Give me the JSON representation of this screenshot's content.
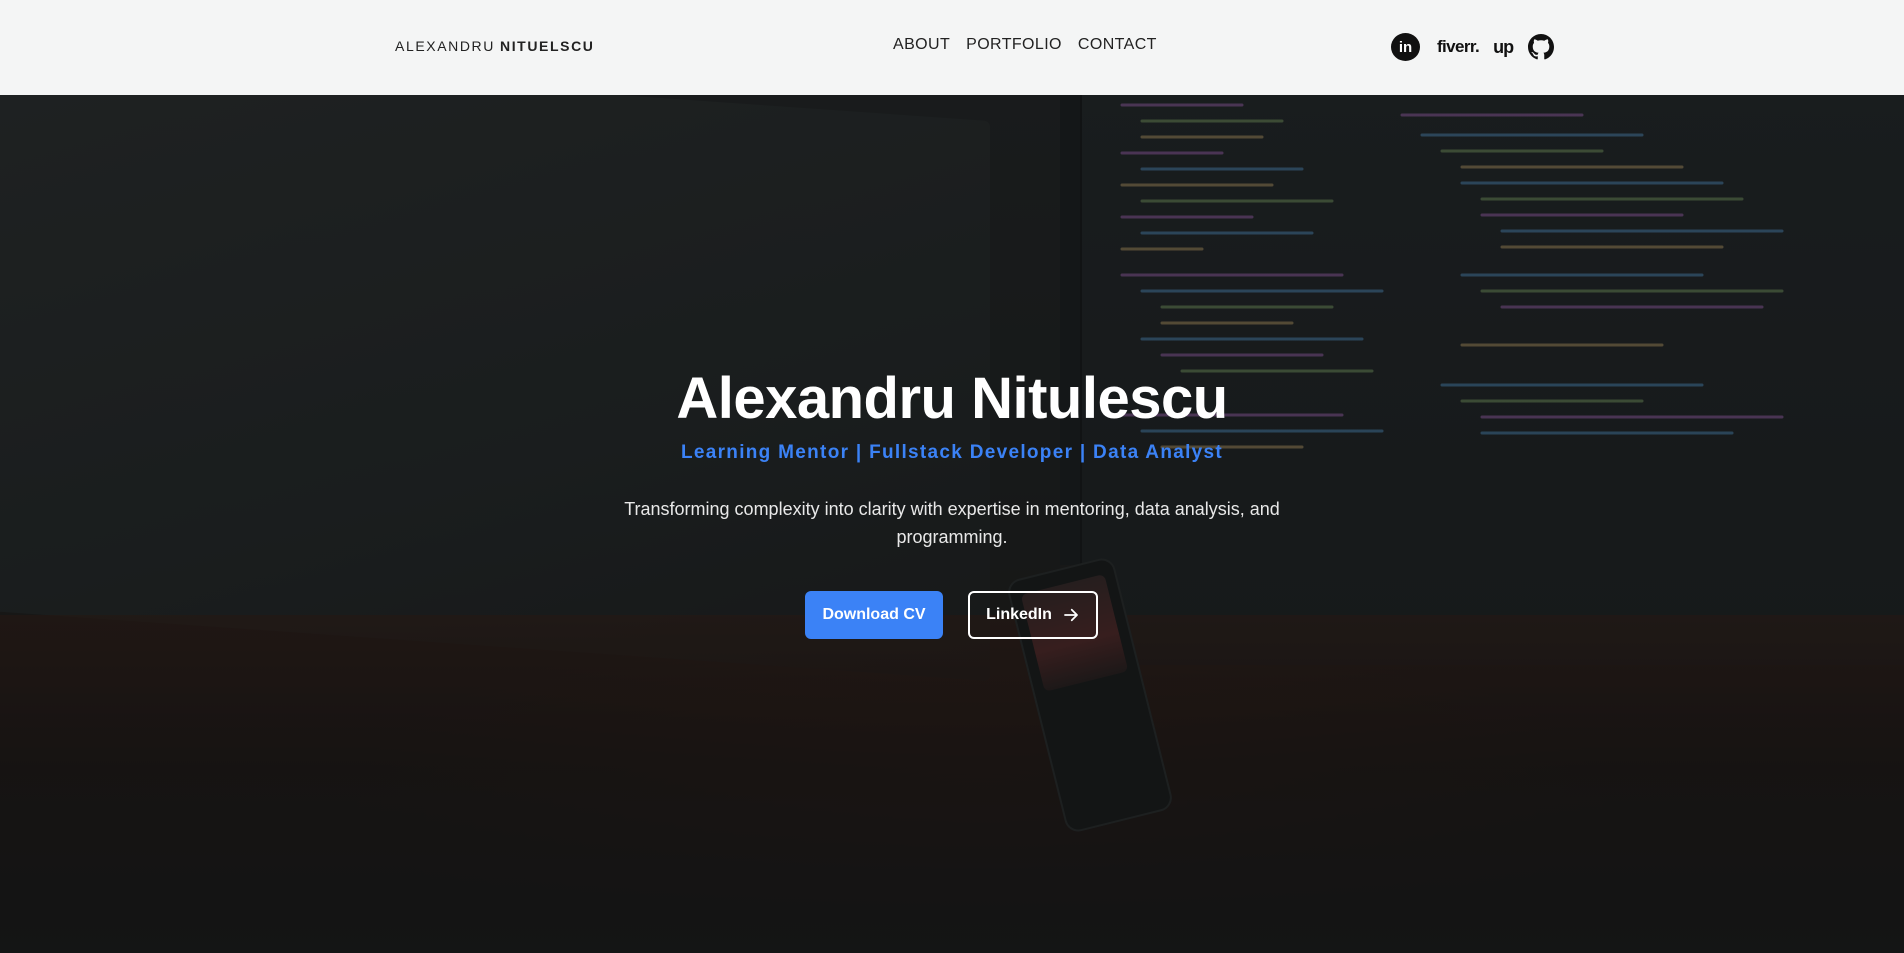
{
  "header": {
    "brand_first": "ALEXANDRU",
    "brand_last": "NITUELSCU",
    "nav": [
      {
        "label": "ABOUT"
      },
      {
        "label": "PORTFOLIO"
      },
      {
        "label": "CONTACT"
      }
    ],
    "socials": {
      "linkedin": "in",
      "fiverr": "fiverr.",
      "upwork": "up"
    }
  },
  "hero": {
    "name": "Alexandru Nitulescu",
    "tagline": "Learning Mentor | Fullstack Developer | Data Analyst",
    "description": "Transforming complexity into clarity with expertise in mentoring, data analysis, and programming.",
    "buttons": {
      "download_cv": "Download CV",
      "linkedin": "LinkedIn"
    }
  },
  "colors": {
    "accent": "#3b82f6",
    "header_bg": "#f4f5f5",
    "hero_text": "#ffffff"
  },
  "icons": [
    "linkedin-icon",
    "fiverr-icon",
    "upwork-icon",
    "github-icon",
    "arrow-right-icon"
  ]
}
